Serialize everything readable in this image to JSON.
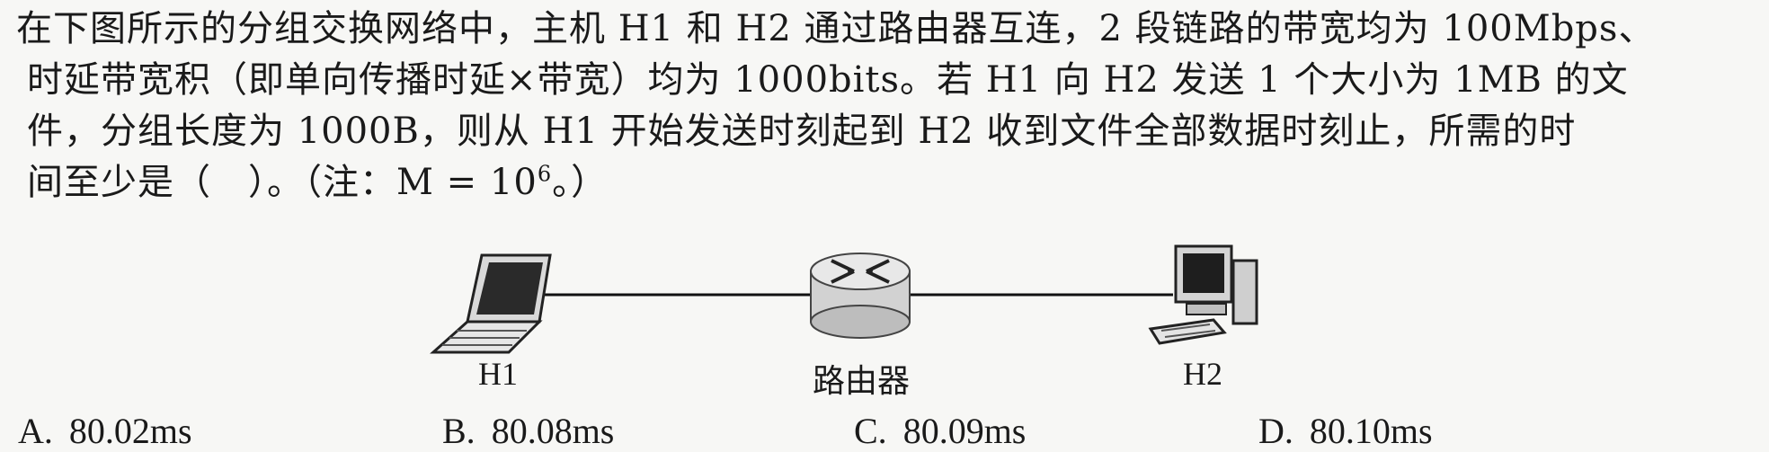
{
  "question": {
    "lines": [
      "在下图所示的分组交换网络中，主机 H1 和 H2 通过路由器互连，2 段链路的带宽均为 100Mbps、",
      "时延带宽积（即单向传播时延×带宽）均为 1000bits。若 H1 向 H2 发送 1 个大小为 1MB 的文",
      "件，分组长度为 1000B，则从 H1 开始发送时刻起到 H2 收到文件全部数据时刻止，所需的时"
    ],
    "last_line_prefix": "间至少是（　）。（注：M = 10",
    "exponent": "6",
    "last_line_suffix": "。）"
  },
  "diagram": {
    "h1_label": "H1",
    "router_label": "路由器",
    "h2_label": "H2",
    "h1_icon": "laptop-icon",
    "router_icon": "router-icon",
    "h2_icon": "desktop-computer-icon"
  },
  "choices": [
    {
      "letter": "A.",
      "text": "80.02ms"
    },
    {
      "letter": "B.",
      "text": "80.08ms"
    },
    {
      "letter": "C.",
      "text": "80.09ms"
    },
    {
      "letter": "D.",
      "text": "80.10ms"
    }
  ]
}
